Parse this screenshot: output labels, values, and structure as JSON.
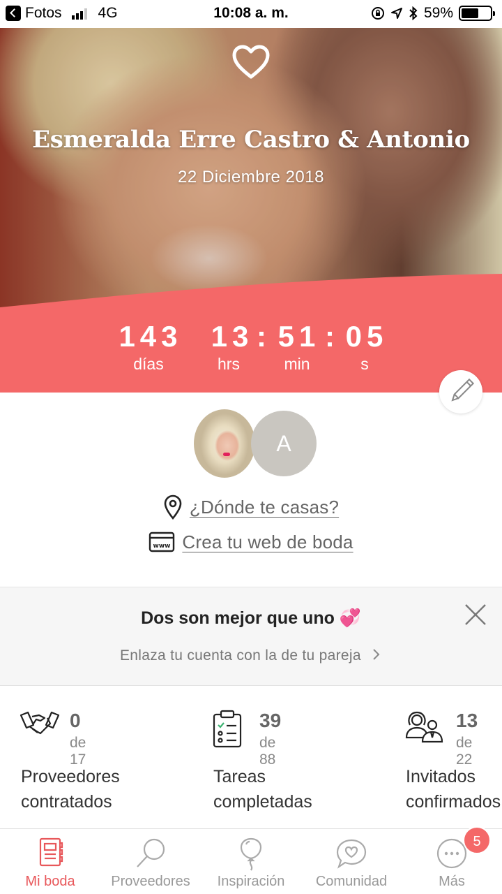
{
  "status_bar": {
    "back_app": "Fotos",
    "network": "4G",
    "time": "10:08 a. m.",
    "battery": "59%",
    "battery_level": 0.59
  },
  "hero": {
    "couple_name": "Esmeralda Erre Castro & Antonio",
    "wedding_date": "22 Diciembre 2018",
    "accent_color": "#f46868"
  },
  "countdown": {
    "days": "143",
    "hours": "13",
    "minutes": "51",
    "seconds": "05",
    "separator": ":",
    "days_label": "días",
    "hours_label": "hrs",
    "minutes_label": "min",
    "seconds_label": "s"
  },
  "profile": {
    "partner_initial": "A",
    "where_link": "¿Dónde te casas?",
    "web_link": "Crea tu web de boda"
  },
  "banner": {
    "title": "Dos son mejor que uno 💞",
    "subtitle": "Enlaza tu cuenta con la de tu pareja"
  },
  "stats": [
    {
      "value": "0",
      "total": "de 17",
      "label_line1": "Proveedores",
      "label_line2": "contratados",
      "icon": "handshake-icon"
    },
    {
      "value": "39",
      "total": "de 88",
      "label_line1": "Tareas",
      "label_line2": "completadas",
      "icon": "checklist-icon"
    },
    {
      "value": "13",
      "total": "de 22",
      "label_line1": "Invitados",
      "label_line2": "confirmados",
      "icon": "guests-icon"
    }
  ],
  "tabbar": {
    "items": [
      {
        "label": "Mi boda",
        "icon": "notebook-icon",
        "active": true
      },
      {
        "label": "Proveedores",
        "icon": "magnifier-icon",
        "active": false
      },
      {
        "label": "Inspiración",
        "icon": "balloon-icon",
        "active": false
      },
      {
        "label": "Comunidad",
        "icon": "chat-heart-icon",
        "active": false
      },
      {
        "label": "Más",
        "icon": "more-icon",
        "active": false
      }
    ],
    "more_badge": "5"
  }
}
